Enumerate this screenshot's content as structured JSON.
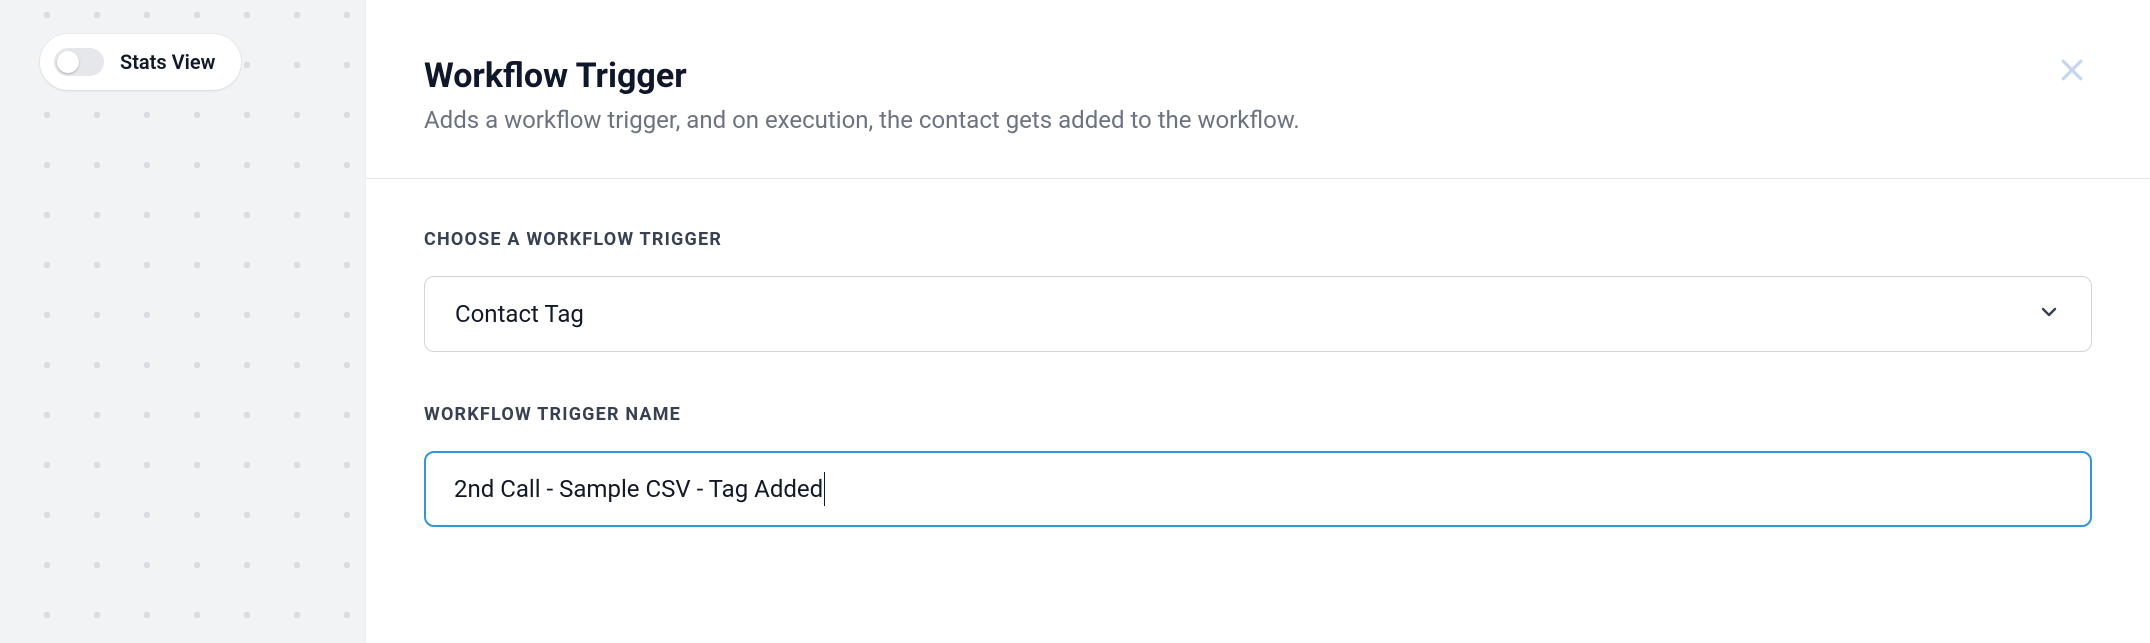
{
  "sidebar": {
    "stats_view_label": "Stats View",
    "stats_view_on": false
  },
  "panel": {
    "title": "Workflow Trigger",
    "subtitle": "Adds a workflow trigger, and on execution, the contact gets added to the workflow.",
    "close_icon": "close-icon"
  },
  "form": {
    "trigger_select": {
      "label": "CHOOSE A WORKFLOW TRIGGER",
      "value": "Contact Tag"
    },
    "trigger_name": {
      "label": "WORKFLOW TRIGGER NAME",
      "value": "2nd Call - Sample CSV - Tag Added"
    }
  }
}
